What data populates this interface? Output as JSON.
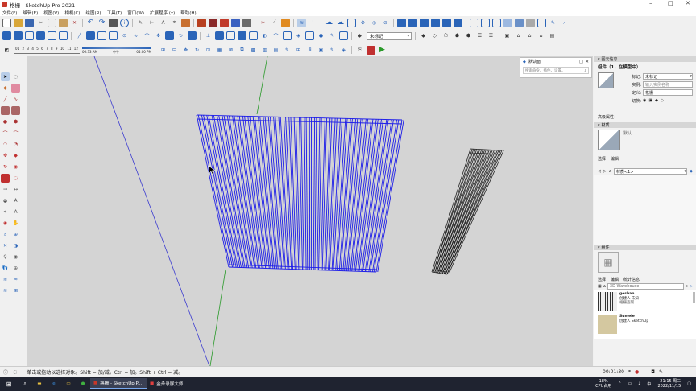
{
  "window": {
    "title": "格栅 - SketchUp Pro 2021",
    "minimize": "–",
    "maximize": "□",
    "close": "✕"
  },
  "menu": [
    "文件(F)",
    "编辑(E)",
    "视图(V)",
    "相机(C)",
    "绘图(R)",
    "工具(T)",
    "窗口(W)",
    "扩展程序 (x)",
    "帮助(H)"
  ],
  "toolbar": {
    "tag_dropdown": "未标记",
    "shadow_times": [
      "01",
      "2",
      "3",
      "4",
      "5",
      "6",
      "7",
      "8",
      "9",
      "10",
      "11",
      "12"
    ],
    "time_start": "06:33 AM",
    "time_mid": "中午",
    "time_end": "05:00 PM"
  },
  "search_popup": {
    "title": "默认面",
    "placeholder": "搜索命令、插件、设置。"
  },
  "entity_info": {
    "panel_title": "图元信息",
    "heading": "组件（1，在模型中）",
    "tag_label": "标记:",
    "tag_value": "未标记",
    "instance_label": "实例:",
    "instance_placeholder": "输入实例名称",
    "definition_label": "定义:",
    "definition_value": "格栅",
    "toggle_label": "切换:",
    "advanced_label": "高级属性："
  },
  "materials": {
    "panel_title": "材质",
    "current": "默认",
    "tab_select": "选择",
    "tab_edit": "编辑",
    "dropdown": "材质<1>"
  },
  "components": {
    "panel_title": "组件",
    "tab_select": "选择",
    "tab_edit": "编辑",
    "tab_stats": "统计信息",
    "search_placeholder": "3D Warehouse",
    "items": [
      {
        "name": "geshan",
        "line1": "创建人 未知",
        "line2": "格栅盗网"
      },
      {
        "name": "Sumele",
        "line1": "创建人 SketchUp",
        "line2": ""
      }
    ]
  },
  "status": {
    "text": "单击或拖动以选择对象。Shift = 加/减。Ctrl = 加。Shift + Ctrl = 减。",
    "timer": "00:01:30"
  },
  "taskbar": {
    "apps": [
      {
        "label": "格栅 - SketchUp P..."
      },
      {
        "label": "金舟录屏大师"
      }
    ],
    "cpu": "18%",
    "cpu_label": "CPU占用",
    "time": "21:15 周二",
    "date": "2022/11/15"
  },
  "colors": {
    "accent": "#2a64b8",
    "grid_left": "#1e1ee8",
    "grid_right": "#222222",
    "axis_green": "#2a9a2a",
    "axis_blue": "#3b3bd0"
  }
}
